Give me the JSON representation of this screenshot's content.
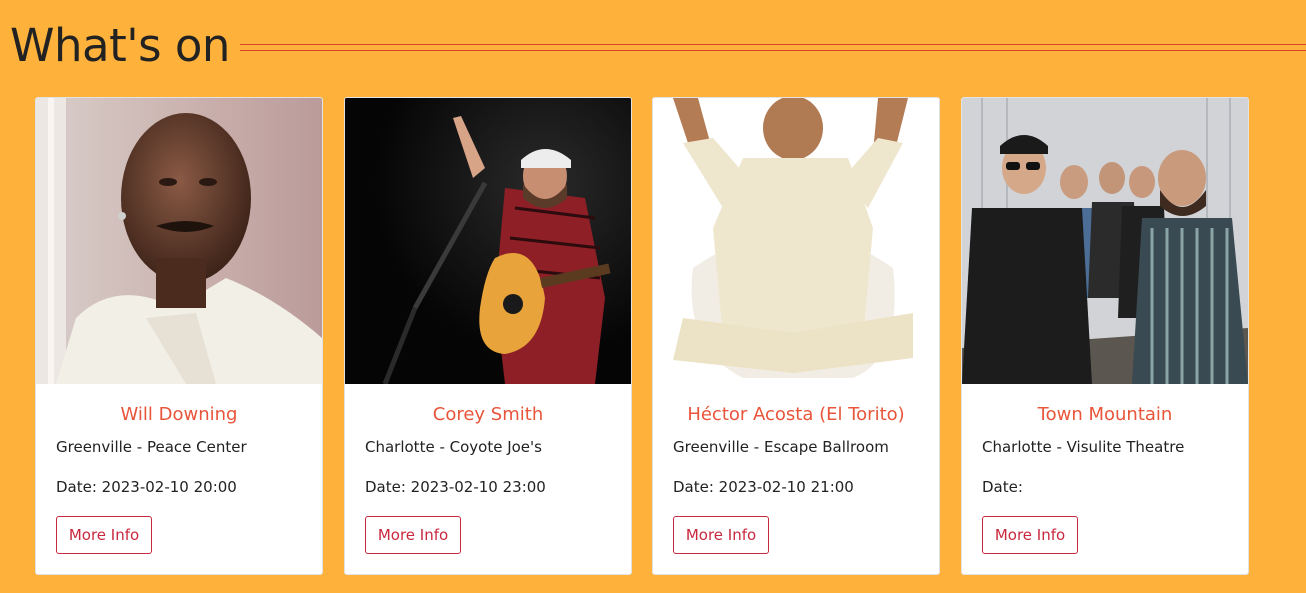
{
  "section": {
    "title": "What's on",
    "accent_color": "#D8432B",
    "background_color": "#FFB23B"
  },
  "events": [
    {
      "name": "Will Downing",
      "venue": "Greenville - Peace Center",
      "date": "Date: 2023-02-10 20:00",
      "button_label": "More Info"
    },
    {
      "name": "Corey Smith",
      "venue": "Charlotte - Coyote Joe's",
      "date": "Date: 2023-02-10 23:00",
      "button_label": "More Info"
    },
    {
      "name": "Héctor Acosta (El Torito)",
      "venue": "Greenville - Escape Ballroom",
      "date": "Date: 2023-02-10 21:00",
      "button_label": "More Info"
    },
    {
      "name": "Town Mountain",
      "venue": "Charlotte - Visulite Theatre",
      "date": "Date:",
      "button_label": "More Info"
    }
  ]
}
